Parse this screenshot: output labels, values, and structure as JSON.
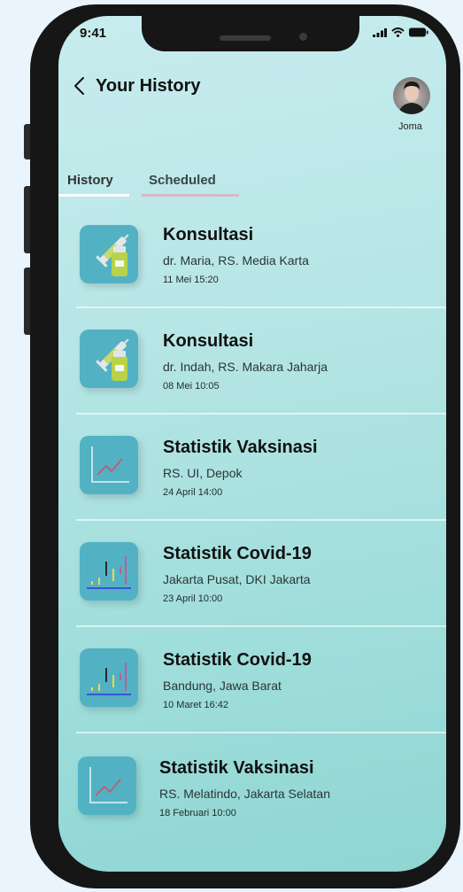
{
  "status_bar": {
    "time": "9:41"
  },
  "header": {
    "title": "Your History"
  },
  "profile": {
    "name": "Joma"
  },
  "tabs": [
    {
      "label": "History",
      "active": true
    },
    {
      "label": "Scheduled",
      "active": false
    }
  ],
  "items": [
    {
      "icon": "vaccine-icon",
      "title": "Konsultasi",
      "subtitle": "dr. Maria, RS. Media Karta",
      "date": "11 Mei 15:20"
    },
    {
      "icon": "vaccine-icon",
      "title": "Konsultasi",
      "subtitle": "dr. Indah, RS. Makara Jaharja",
      "date": "08 Mei 10:05"
    },
    {
      "icon": "line-chart-icon",
      "title": "Statistik Vaksinasi",
      "subtitle": "RS. UI, Depok",
      "date": "24 April 14:00"
    },
    {
      "icon": "candlestick-chart-icon",
      "title": "Statistik Covid-19",
      "subtitle": "Jakarta Pusat, DKI Jakarta",
      "date": "23 April 10:00"
    },
    {
      "icon": "candlestick-chart-icon",
      "title": "Statistik Covid-19",
      "subtitle": "Bandung, Jawa Barat",
      "date": "10 Maret 16:42"
    },
    {
      "icon": "line-chart-icon",
      "title": "Statistik Vaksinasi",
      "subtitle": "RS. Melatindo, Jakarta Selatan",
      "date": "18 Februari 10:00"
    }
  ],
  "colors": {
    "accent": "#52b2c4",
    "screen_top": "#c8ecee",
    "screen_bottom": "#8fd6d3"
  }
}
